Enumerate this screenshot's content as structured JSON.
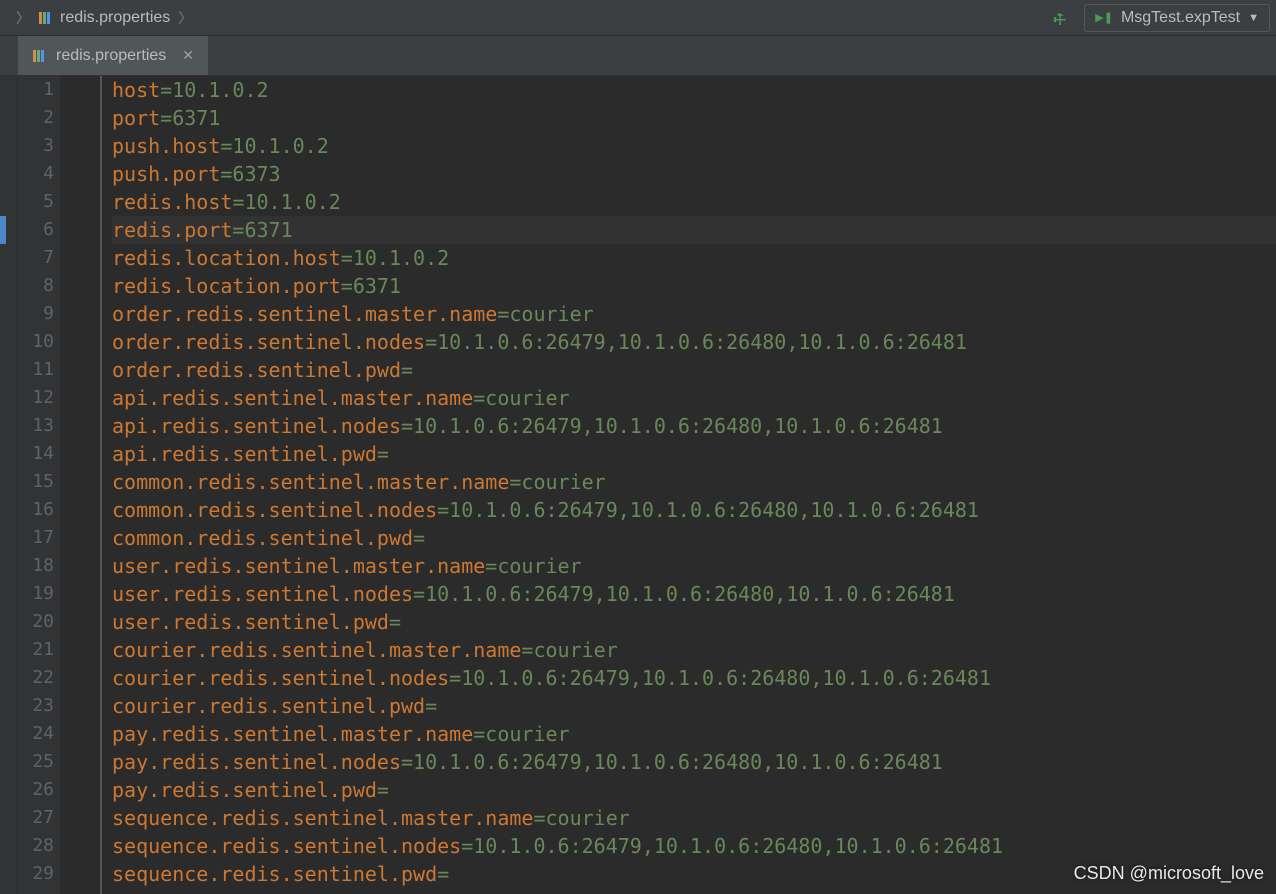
{
  "breadcrumb": {
    "file": "redis.properties"
  },
  "runConfig": {
    "label": "MsgTest.expTest"
  },
  "tab": {
    "file": "redis.properties"
  },
  "currentLine": 6,
  "lines": [
    {
      "n": 1,
      "key": "host",
      "val": "10.1.0.2"
    },
    {
      "n": 2,
      "key": "port",
      "val": "6371"
    },
    {
      "n": 3,
      "key": "push.host",
      "val": "10.1.0.2"
    },
    {
      "n": 4,
      "key": "push.port",
      "val": "6373"
    },
    {
      "n": 5,
      "key": "redis.host",
      "val": "10.1.0.2"
    },
    {
      "n": 6,
      "key": "redis.port",
      "val": "6371"
    },
    {
      "n": 7,
      "key": "redis.location.host",
      "val": "10.1.0.2"
    },
    {
      "n": 8,
      "key": "redis.location.port",
      "val": "6371"
    },
    {
      "n": 9,
      "key": "order.redis.sentinel.master.name",
      "val": "courier"
    },
    {
      "n": 10,
      "key": "order.redis.sentinel.nodes",
      "val": "10.1.0.6:26479,10.1.0.6:26480,10.1.0.6:26481"
    },
    {
      "n": 11,
      "key": "order.redis.sentinel.pwd",
      "val": ""
    },
    {
      "n": 12,
      "key": "api.redis.sentinel.master.name",
      "val": "courier"
    },
    {
      "n": 13,
      "key": "api.redis.sentinel.nodes",
      "val": "10.1.0.6:26479,10.1.0.6:26480,10.1.0.6:26481"
    },
    {
      "n": 14,
      "key": "api.redis.sentinel.pwd",
      "val": ""
    },
    {
      "n": 15,
      "key": "common.redis.sentinel.master.name",
      "val": "courier"
    },
    {
      "n": 16,
      "key": "common.redis.sentinel.nodes",
      "val": "10.1.0.6:26479,10.1.0.6:26480,10.1.0.6:26481"
    },
    {
      "n": 17,
      "key": "common.redis.sentinel.pwd",
      "val": ""
    },
    {
      "n": 18,
      "key": "user.redis.sentinel.master.name",
      "val": "courier"
    },
    {
      "n": 19,
      "key": "user.redis.sentinel.nodes",
      "val": "10.1.0.6:26479,10.1.0.6:26480,10.1.0.6:26481"
    },
    {
      "n": 20,
      "key": "user.redis.sentinel.pwd",
      "val": ""
    },
    {
      "n": 21,
      "key": "courier.redis.sentinel.master.name",
      "val": "courier"
    },
    {
      "n": 22,
      "key": "courier.redis.sentinel.nodes",
      "val": "10.1.0.6:26479,10.1.0.6:26480,10.1.0.6:26481"
    },
    {
      "n": 23,
      "key": "courier.redis.sentinel.pwd",
      "val": ""
    },
    {
      "n": 24,
      "key": "pay.redis.sentinel.master.name",
      "val": "courier"
    },
    {
      "n": 25,
      "key": "pay.redis.sentinel.nodes",
      "val": "10.1.0.6:26479,10.1.0.6:26480,10.1.0.6:26481"
    },
    {
      "n": 26,
      "key": "pay.redis.sentinel.pwd",
      "val": ""
    },
    {
      "n": 27,
      "key": "sequence.redis.sentinel.master.name",
      "val": "courier"
    },
    {
      "n": 28,
      "key": "sequence.redis.sentinel.nodes",
      "val": "10.1.0.6:26479,10.1.0.6:26480,10.1.0.6:26481"
    },
    {
      "n": 29,
      "key": "sequence.redis.sentinel.pwd",
      "val": ""
    }
  ],
  "watermark": "CSDN @microsoft_love"
}
